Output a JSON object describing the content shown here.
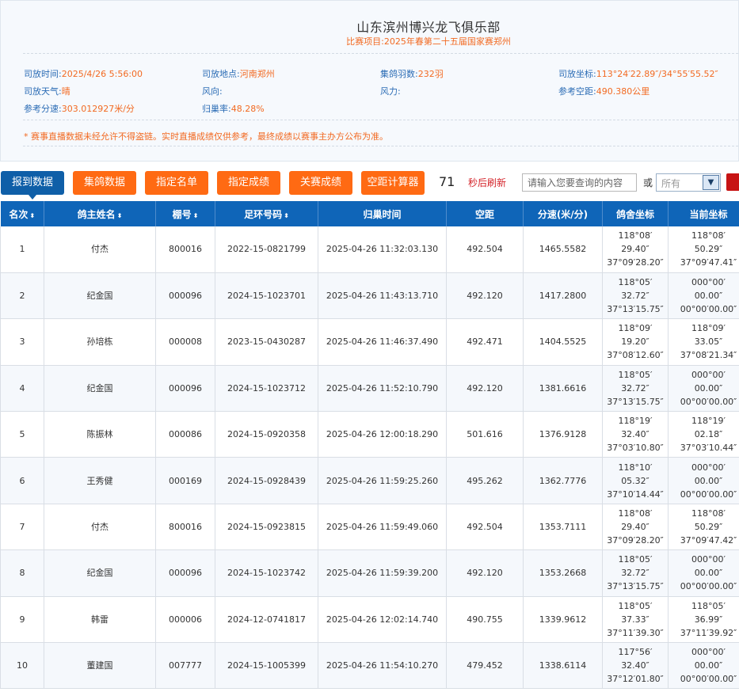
{
  "header": {
    "club_name": "山东滨州博兴龙飞俱乐部",
    "race_label": "比赛项目:",
    "race_name": "2025年春第二十五届国家赛郑州"
  },
  "info": {
    "release_time": {
      "label": "司放时间:",
      "value": "2025/4/26 5:56:00"
    },
    "release_place": {
      "label": "司放地点:",
      "value": "河南郑州"
    },
    "birds": {
      "label": "集鸽羽数:",
      "value": "232羽"
    },
    "release_coord": {
      "label": "司放坐标:",
      "value": "113°24′22.89″/34°55′55.52″"
    },
    "weather": {
      "label": "司放天气:",
      "value": "晴"
    },
    "wind_dir": {
      "label": "风向:",
      "value": ""
    },
    "wind_force": {
      "label": "风力:",
      "value": ""
    },
    "ref_distance": {
      "label": "参考空距:",
      "value": "490.380公里"
    },
    "ref_speed": {
      "label": "参考分速:",
      "value": "303.012927米/分"
    },
    "return_rate": {
      "label": "归巢率:",
      "value": "48.28%"
    },
    "notice": "* 赛事直播数据未经允许不得盗链。实时直播成绩仅供参考，最终成绩以赛事主办方公布为准。"
  },
  "toolbar": {
    "buttons": [
      "报到数据",
      "集鸽数据",
      "指定名单",
      "指定成绩",
      "关赛成绩",
      "空距计算器"
    ],
    "countdown": "71",
    "refresh_text": "秒后刷新",
    "search_placeholder": "请输入您要查询的内容",
    "or_text": "或",
    "select_value": "所有"
  },
  "table": {
    "columns": [
      "名次",
      "鸽主姓名",
      "棚号",
      "足环号码",
      "归巢时间",
      "空距",
      "分速(米/分)",
      "鸽舍坐标",
      "当前坐标"
    ],
    "rows": [
      {
        "rank": "1",
        "name": "付杰",
        "shed": "800016",
        "ring": "2022-15-0821799",
        "time": "2025-04-26 11:32:03.130",
        "dist": "492.504",
        "speed": "1465.5582",
        "loft": [
          "118°08′",
          "29.40″",
          "37°09′28.20″"
        ],
        "cur": [
          "118°08′",
          "50.29″",
          "37°09′47.41″"
        ]
      },
      {
        "rank": "2",
        "name": "纪金国",
        "shed": "000096",
        "ring": "2024-15-1023701",
        "time": "2025-04-26 11:43:13.710",
        "dist": "492.120",
        "speed": "1417.2800",
        "loft": [
          "118°05′",
          "32.72″",
          "37°13′15.75″"
        ],
        "cur": [
          "000°00′",
          "00.00″",
          "00°00′00.00″"
        ]
      },
      {
        "rank": "3",
        "name": "孙培栋",
        "shed": "000008",
        "ring": "2023-15-0430287",
        "time": "2025-04-26 11:46:37.490",
        "dist": "492.471",
        "speed": "1404.5525",
        "loft": [
          "118°09′",
          "19.20″",
          "37°08′12.60″"
        ],
        "cur": [
          "118°09′",
          "33.05″",
          "37°08′21.34″"
        ]
      },
      {
        "rank": "4",
        "name": "纪金国",
        "shed": "000096",
        "ring": "2024-15-1023712",
        "time": "2025-04-26 11:52:10.790",
        "dist": "492.120",
        "speed": "1381.6616",
        "loft": [
          "118°05′",
          "32.72″",
          "37°13′15.75″"
        ],
        "cur": [
          "000°00′",
          "00.00″",
          "00°00′00.00″"
        ]
      },
      {
        "rank": "5",
        "name": "陈振林",
        "shed": "000086",
        "ring": "2024-15-0920358",
        "time": "2025-04-26 12:00:18.290",
        "dist": "501.616",
        "speed": "1376.9128",
        "loft": [
          "118°19′",
          "32.40″",
          "37°03′10.80″"
        ],
        "cur": [
          "118°19′",
          "02.18″",
          "37°03′10.44″"
        ]
      },
      {
        "rank": "6",
        "name": "王秀健",
        "shed": "000169",
        "ring": "2024-15-0928439",
        "time": "2025-04-26 11:59:25.260",
        "dist": "495.262",
        "speed": "1362.7776",
        "loft": [
          "118°10′",
          "05.32″",
          "37°10′14.44″"
        ],
        "cur": [
          "000°00′",
          "00.00″",
          "00°00′00.00″"
        ]
      },
      {
        "rank": "7",
        "name": "付杰",
        "shed": "800016",
        "ring": "2024-15-0923815",
        "time": "2025-04-26 11:59:49.060",
        "dist": "492.504",
        "speed": "1353.7111",
        "loft": [
          "118°08′",
          "29.40″",
          "37°09′28.20″"
        ],
        "cur": [
          "118°08′",
          "50.29″",
          "37°09′47.42″"
        ]
      },
      {
        "rank": "8",
        "name": "纪金国",
        "shed": "000096",
        "ring": "2024-15-1023742",
        "time": "2025-04-26 11:59:39.200",
        "dist": "492.120",
        "speed": "1353.2668",
        "loft": [
          "118°05′",
          "32.72″",
          "37°13′15.75″"
        ],
        "cur": [
          "000°00′",
          "00.00″",
          "00°00′00.00″"
        ]
      },
      {
        "rank": "9",
        "name": "韩雷",
        "shed": "000006",
        "ring": "2024-12-0741817",
        "time": "2025-04-26 12:02:14.740",
        "dist": "490.755",
        "speed": "1339.9612",
        "loft": [
          "118°05′",
          "37.33″",
          "37°11′39.30″"
        ],
        "cur": [
          "118°05′",
          "36.99″",
          "37°11′39.92″"
        ]
      },
      {
        "rank": "10",
        "name": "董建国",
        "shed": "007777",
        "ring": "2024-15-1005399",
        "time": "2025-04-26 11:54:10.270",
        "dist": "479.452",
        "speed": "1338.6114",
        "loft": [
          "117°56′",
          "32.40″",
          "37°12′01.80″"
        ],
        "cur": [
          "000°00′",
          "00.00″",
          "00°00′00.00″"
        ]
      }
    ]
  }
}
